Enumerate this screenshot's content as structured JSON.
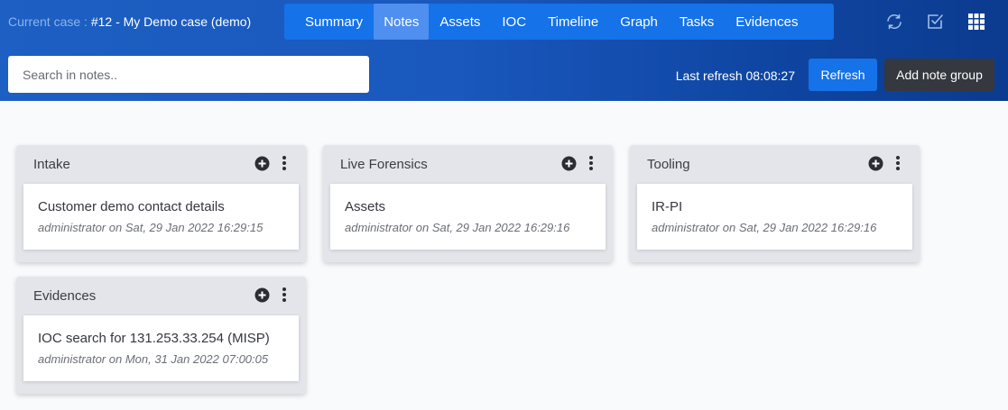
{
  "header": {
    "case_prefix": "Current case : ",
    "case_name": "#12 - My Demo case (demo)",
    "tabs": [
      {
        "label": "Summary"
      },
      {
        "label": "Notes"
      },
      {
        "label": "Assets"
      },
      {
        "label": "IOC"
      },
      {
        "label": "Timeline"
      },
      {
        "label": "Graph"
      },
      {
        "label": "Tasks"
      },
      {
        "label": "Evidences"
      }
    ],
    "active_tab": "Notes",
    "icons": [
      "sync-icon",
      "checkbox-icon",
      "grid-icon"
    ]
  },
  "toolbar": {
    "search_placeholder": "Search in notes..",
    "last_refresh": "Last refresh 08:08:27",
    "refresh_label": "Refresh",
    "add_group_label": "Add note group"
  },
  "groups": [
    {
      "title": "Intake",
      "notes": [
        {
          "title": "Customer demo contact details",
          "meta": "administrator on Sat, 29 Jan 2022 16:29:15"
        }
      ]
    },
    {
      "title": "Live Forensics",
      "notes": [
        {
          "title": "Assets",
          "meta": "administrator on Sat, 29 Jan 2022 16:29:16"
        }
      ]
    },
    {
      "title": "Tooling",
      "notes": [
        {
          "title": "IR-PI",
          "meta": "administrator on Sat, 29 Jan 2022 16:29:16"
        }
      ]
    },
    {
      "title": "Evidences",
      "notes": [
        {
          "title": "IOC search for 131.253.33.254 (MISP)",
          "meta": "administrator on Mon, 31 Jan 2022 07:00:05"
        }
      ]
    }
  ],
  "colors": {
    "header_blue": "#1d5fc2",
    "nav_blue": "#1572e8",
    "active_tab": "#4f8ff0",
    "dark_button": "#35383f",
    "group_bg": "#e4e5ea"
  }
}
